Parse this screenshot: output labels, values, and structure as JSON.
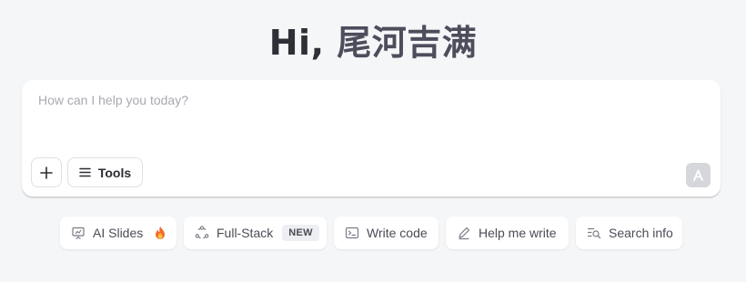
{
  "greeting": {
    "hi": "Hi, ",
    "name": "尾河吉满"
  },
  "composer": {
    "placeholder": "How can I help you today?",
    "tools_label": "Tools"
  },
  "chips": [
    {
      "label": "AI Slides",
      "icon": "presentation-icon",
      "extra_icon": "fire-icon"
    },
    {
      "label": "Full-Stack",
      "icon": "cycle-nodes-icon",
      "badge": "NEW"
    },
    {
      "label": "Write code",
      "icon": "terminal-icon"
    },
    {
      "label": "Help me write",
      "icon": "pen-icon"
    },
    {
      "label": "Search info",
      "icon": "search-list-icon"
    }
  ],
  "colors": {
    "background": "#f5f6f8",
    "fire": "#f26b2a",
    "send_disabled": "#d6d7db"
  }
}
